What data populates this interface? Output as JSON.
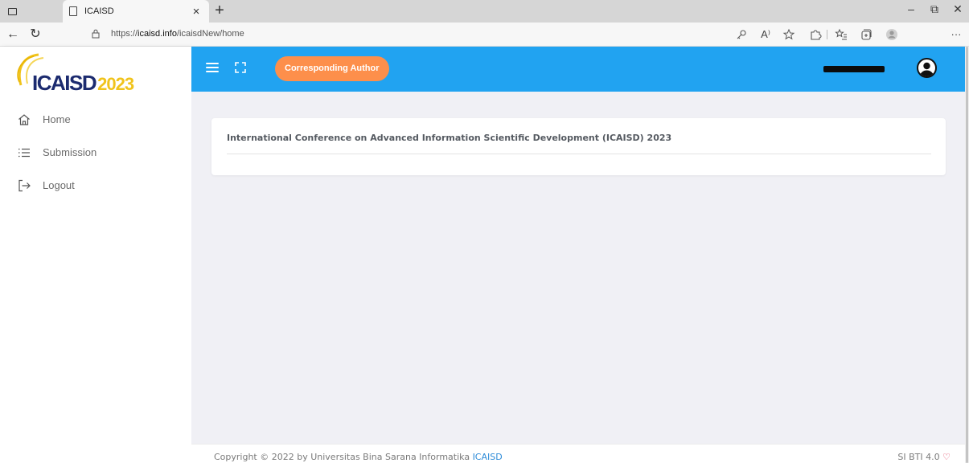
{
  "browser": {
    "tab_title": "ICAISD",
    "tab_close": "×",
    "new_tab": "+",
    "url_prefix": "https://",
    "url_domain": "icaisd.info",
    "url_path": "/icaisdNew/home",
    "window_controls": {
      "minimize": "–",
      "restore": "⧉",
      "close": "✕"
    },
    "nav": {
      "back": "←",
      "refresh": "↻"
    },
    "toolbar_icons": [
      "key-icon",
      "read-aloud-icon",
      "favorite-add-icon",
      "extensions-icon",
      "favorites-icon",
      "collections-icon",
      "profile-icon",
      "more-icon"
    ],
    "toolbar_glyphs": {
      "read_aloud": "A⁾",
      "more": "···"
    }
  },
  "brand": {
    "logo_text": "ICAISD",
    "logo_year": "2023",
    "colors": {
      "navy": "#1c2b6f",
      "gold": "#f0c31c"
    }
  },
  "sidebar": {
    "items": [
      {
        "label": "Home",
        "icon": "home-icon"
      },
      {
        "label": "Submission",
        "icon": "list-icon"
      },
      {
        "label": "Logout",
        "icon": "logout-icon"
      }
    ]
  },
  "topbar": {
    "color": "#21a3f1",
    "role_button": "Corresponding Author",
    "role_button_color": "#fd8f4b"
  },
  "main": {
    "card_title": "International Conference on Advanced Information Scientific Development (ICAISD) 2023"
  },
  "footer": {
    "copyright": "Copyright © 2022 by Universitas Bina Sarana Informatika ",
    "link": "ICAISD",
    "version": "SI BTI 4.0 ",
    "heart": "♡"
  }
}
